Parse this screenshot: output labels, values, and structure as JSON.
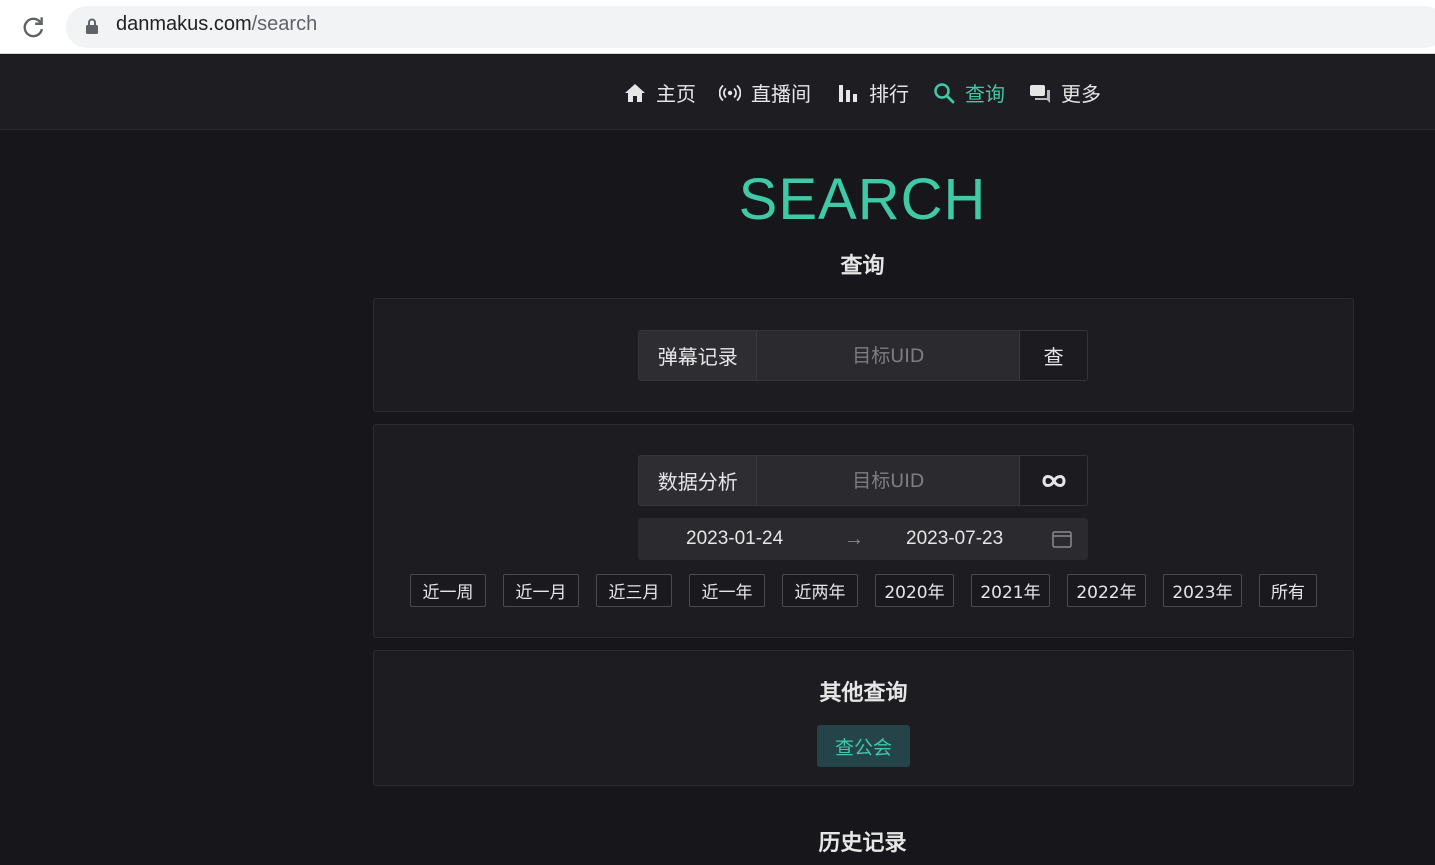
{
  "browser": {
    "url_domain": "danmakus.com",
    "url_path": "/search"
  },
  "nav": {
    "items": [
      {
        "label": "主页",
        "icon": "home-icon"
      },
      {
        "label": "直播间",
        "icon": "broadcast-icon"
      },
      {
        "label": "排行",
        "icon": "bar-chart-icon"
      },
      {
        "label": "查询",
        "icon": "search-icon",
        "active": true
      },
      {
        "label": "更多",
        "icon": "chat-icon"
      }
    ]
  },
  "hero": {
    "title": "SEARCH",
    "subtitle": "查询"
  },
  "danmaku_search": {
    "label": "弹幕记录",
    "placeholder": "目标UID",
    "button_label": "查"
  },
  "analysis": {
    "label": "数据分析",
    "placeholder": "目标UID",
    "button_icon": "infinity-icon",
    "date_start": "2023-01-24",
    "date_end": "2023-07-23",
    "quick_ranges": [
      "近一周",
      "近一月",
      "近三月",
      "近一年",
      "近两年",
      "2020年",
      "2021年",
      "2022年",
      "2023年",
      "所有"
    ]
  },
  "other": {
    "title": "其他查询",
    "guild_button": "查公会"
  },
  "history": {
    "title": "历史记录"
  },
  "colors": {
    "accent": "#3ec9a7",
    "background": "#17171b",
    "panel": "#1d1d21"
  }
}
